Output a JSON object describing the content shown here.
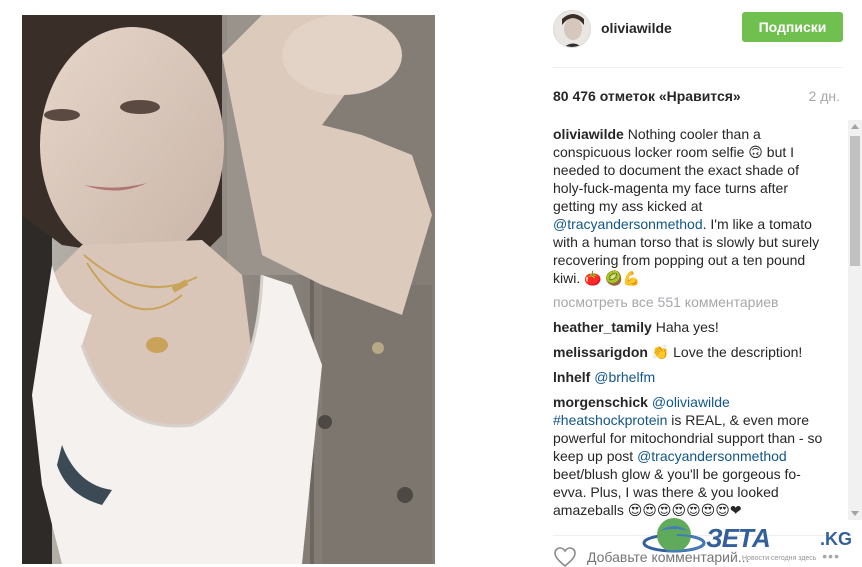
{
  "post": {
    "username": "oliviawilde",
    "follow_label": "Подписки",
    "likes": "80 476 отметок «Нравится»",
    "time_ago": "2 дн.",
    "caption": {
      "user": "oliviawilde",
      "text_before": "Nothing cooler than a conspicuous locker room selfie 🙃 but I needed to document the exact shade of holy-fuck-magenta my face turns after getting my ass kicked at ",
      "mention": "@tracyandersonmethod",
      "text_after": ". I'm like a tomato with a human torso that is slowly but surely recovering from popping out a ten pound kiwi. 🍅 🥝💪"
    },
    "view_all_comments": "посмотреть все 551 комментариев",
    "comments": [
      {
        "user": "heather_tamily",
        "text": "Haha yes!"
      },
      {
        "user": "melissarigdon",
        "text": "👏 Love the description!"
      },
      {
        "user": "lnhelf",
        "mention": "@brhelfm"
      },
      {
        "user": "morgenschick",
        "mention1": "@oliviawilde",
        "hashtag": "#heatshockprotein",
        "text1": " is REAL, & even more powerful for mitochondrial support than - so keep up post ",
        "mention2": "@tracyandersonmethod",
        "text2": " beet/blush glow & you'll be gorgeous fo-evva. Plus, I was there & you looked amazeballs 😍😍😍😍😍😍😍❤"
      }
    ],
    "add_comment_placeholder": "Добавьте комментарий...",
    "more_label": "•••"
  },
  "watermark": {
    "brand": "ЗЕТА",
    "domain": ".KG",
    "tagline": "Новости сегодня здесь"
  },
  "colors": {
    "follow_green": "#70c050",
    "mention_blue": "#125688",
    "muted_gray": "#a5a7aa"
  }
}
